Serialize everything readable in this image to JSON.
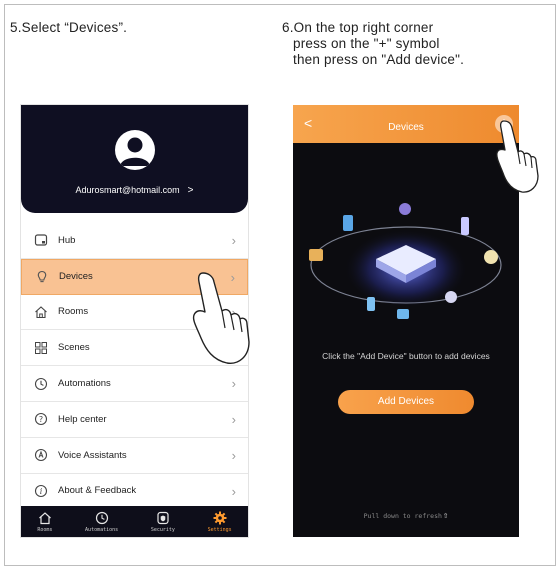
{
  "steps": {
    "step5": "5.Select “Devices”.",
    "step6_line1": "6.On the top right corner",
    "step6_line2": "press on the \"+\" symbol",
    "step6_line3": "then press on \"Add device\"."
  },
  "profile": {
    "email": "Adurosmart@hotmail.com",
    "chevron": ">"
  },
  "menu": [
    {
      "label": "Hub",
      "icon": "hub-icon"
    },
    {
      "label": "Devices",
      "icon": "bulb-icon",
      "selected": true
    },
    {
      "label": "Rooms",
      "icon": "home-icon"
    },
    {
      "label": "Scenes",
      "icon": "scenes-icon"
    },
    {
      "label": "Automations",
      "icon": "clock-icon"
    },
    {
      "label": "Help center",
      "icon": "help-icon"
    },
    {
      "label": "Voice Assistants",
      "icon": "voice-icon"
    },
    {
      "label": "About & Feedback",
      "icon": "info-icon"
    }
  ],
  "tabbar": [
    {
      "label": "Rooms",
      "icon": "home-icon"
    },
    {
      "label": "Automations",
      "icon": "clock-icon"
    },
    {
      "label": "Security",
      "icon": "shield-icon"
    },
    {
      "label": "Settings",
      "icon": "gear-icon",
      "active": true
    }
  ],
  "devices_screen": {
    "back": "<",
    "title": "Devices",
    "plus": "+",
    "hint": "Click the \"Add Device\" button to add devices",
    "add_button": "Add Devices",
    "refresh": "Pull down to refresh",
    "refresh_icon": "arrow-up-icon"
  },
  "colors": {
    "accent": "#ef8a2f",
    "selected_bg": "#f9c293",
    "dark_bg": "#0f0f22"
  }
}
